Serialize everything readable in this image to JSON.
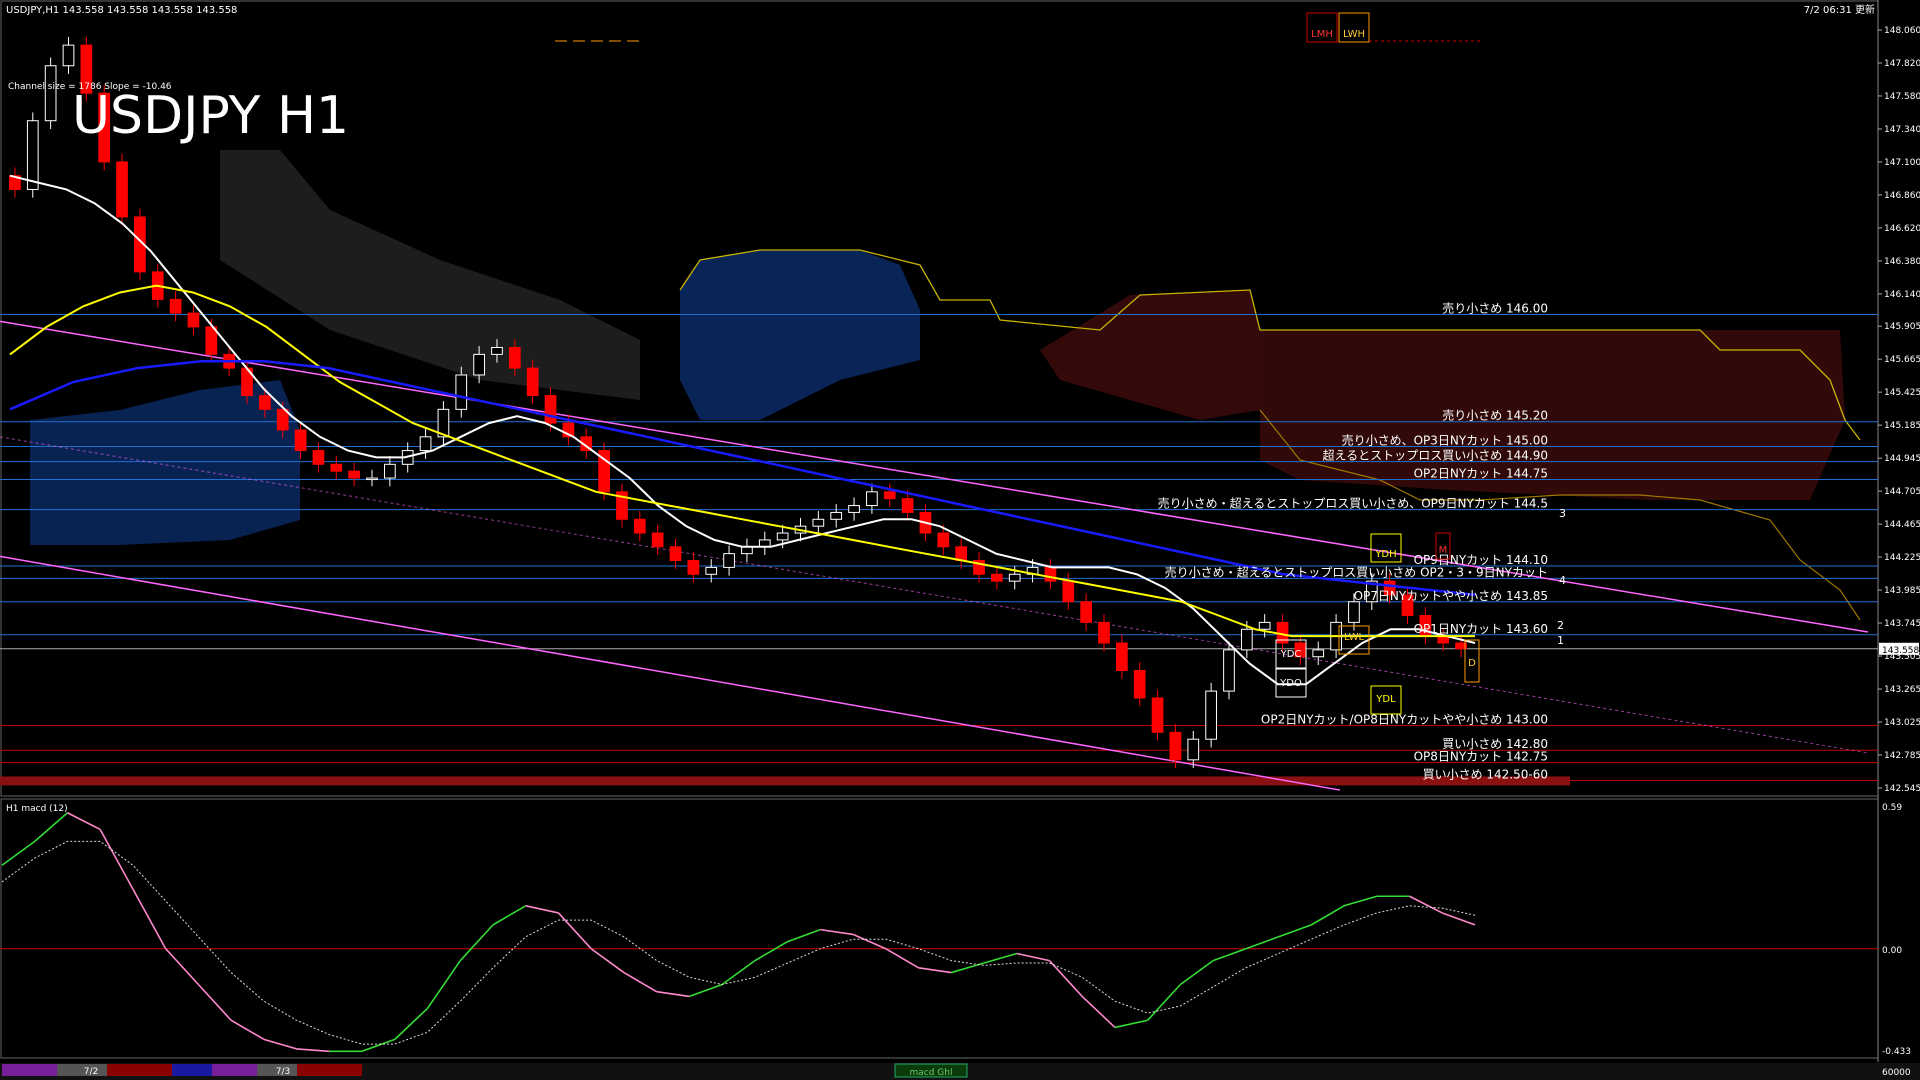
{
  "header": {
    "symbol_info": "USDJPY,H1  143.558 143.558 143.558 143.558",
    "datetime": "7/2 06:31 更新"
  },
  "big_title": "USDJPY H1",
  "channel_text": "Channel size = 1786 Slope = -10.46",
  "top_boxes": {
    "lmh": "LMH",
    "lwh": "LWH"
  },
  "price_axis": {
    "ticks": [
      "148.060",
      "147.820",
      "147.580",
      "147.340",
      "147.100",
      "146.860",
      "146.620",
      "146.380",
      "146.140",
      "145.905",
      "145.665",
      "145.425",
      "145.185",
      "144.945",
      "144.705",
      "144.465",
      "144.225",
      "143.985",
      "143.745",
      "143.505",
      "143.265",
      "143.025",
      "142.785",
      "142.545"
    ],
    "current": "143.558"
  },
  "annotations": [
    {
      "text": "売り小さめ 146.00",
      "price": 145.99
    },
    {
      "text": "売り小さめ 145.20",
      "price": 145.21
    },
    {
      "text": "売り小さめ、OP3日NYカット 145.00",
      "price": 145.03
    },
    {
      "text": "超えるとストップロス買い小さめ 144.90",
      "price": 144.92
    },
    {
      "text": "OP2日NYカット 144.75",
      "price": 144.79
    },
    {
      "text": "売り小さめ・超えるとストップロス買い小さめ、OP9日NYカット 144.5",
      "price": 144.57
    },
    {
      "text": "OP9日NYカット 144.10",
      "price": 144.16
    },
    {
      "text": "売り小さめ・超えるとストップロス買い小さめ OP2・3・9日NYカット",
      "price": 144.07
    },
    {
      "text": "OP7日NYカットやや小さめ 143.85",
      "price": 143.9
    },
    {
      "text": "OP1日NYカット 143.60",
      "price": 143.66
    },
    {
      "text": "OP2日NYカット/OP8日NYカットやや小さめ 143.00",
      "price": 143.0
    },
    {
      "text": "買い小さめ 142.80",
      "price": 142.82
    },
    {
      "text": "OP8日NYカット 142.75",
      "price": 142.73
    },
    {
      "text": "買い小さめ 142.50-60",
      "price": 142.6
    }
  ],
  "level_marks": [
    "3",
    "4",
    "2",
    "1"
  ],
  "boxes": {
    "ydh": "YDH",
    "ydc": "YDC",
    "ydo": "YDO",
    "ydl": "YDL",
    "lwl": "LWL",
    "m": "M",
    "d": "D"
  },
  "macd": {
    "label": "H1  macd (12)",
    "ticks": [
      "0.59",
      "0.00",
      "-0.433"
    ],
    "zero": 0.0
  },
  "bottom_bar": {
    "dates": [
      "7/2",
      "7/3"
    ],
    "tab": "macd Ghl",
    "right": "60000"
  },
  "colors": {
    "background": "#000000",
    "bull": "#ffffff",
    "bear": "#ff0000",
    "ma_white": "#ffffff",
    "ma_yellow": "#ffff00",
    "ma_blue": "#1a1aff",
    "channel": "#ff66ff",
    "level_line": "#1f6fd0",
    "support_line": "#c00000",
    "macd_up": "#33dd33",
    "macd_down": "#ff88cc"
  },
  "chart_data": {
    "type": "candlestick",
    "symbol": "USDJPY",
    "timeframe": "H1",
    "ylim": [
      142.545,
      148.06
    ],
    "close": [
      146.9,
      147.4,
      147.8,
      147.95,
      147.6,
      147.1,
      146.7,
      146.3,
      146.1,
      146.0,
      145.9,
      145.7,
      145.6,
      145.4,
      145.3,
      145.15,
      145.0,
      144.9,
      144.85,
      144.8,
      144.8,
      144.9,
      145.0,
      145.1,
      145.3,
      145.55,
      145.7,
      145.75,
      145.6,
      145.4,
      145.2,
      145.1,
      145.0,
      144.7,
      144.5,
      144.4,
      144.3,
      144.2,
      144.1,
      144.15,
      144.25,
      144.3,
      144.35,
      144.4,
      144.45,
      144.5,
      144.55,
      144.6,
      144.7,
      144.65,
      144.55,
      144.4,
      144.3,
      144.2,
      144.1,
      144.05,
      144.1,
      144.15,
      144.05,
      143.9,
      143.75,
      143.6,
      143.4,
      143.2,
      142.95,
      142.75,
      142.9,
      143.25,
      143.55,
      143.7,
      143.75,
      143.6,
      143.5,
      143.55,
      143.75,
      143.9,
      144.05,
      143.95,
      143.8,
      143.65,
      143.6,
      143.558
    ],
    "ma_white": [
      147.0,
      146.95,
      146.9,
      146.8,
      146.65,
      146.45,
      146.2,
      145.95,
      145.7,
      145.45,
      145.25,
      145.1,
      145.0,
      144.95,
      144.95,
      145.0,
      145.1,
      145.2,
      145.25,
      145.2,
      145.1,
      144.95,
      144.8,
      144.6,
      144.45,
      144.35,
      144.3,
      144.3,
      144.35,
      144.4,
      144.45,
      144.5,
      144.5,
      144.45,
      144.35,
      144.25,
      144.2,
      144.15,
      144.15,
      144.15,
      144.1,
      144.0,
      143.85,
      143.65,
      143.45,
      143.3,
      143.3,
      143.45,
      143.6,
      143.7,
      143.7,
      143.65,
      143.6
    ],
    "ma_yellow": [
      145.7,
      145.9,
      146.05,
      146.15,
      146.2,
      146.15,
      146.05,
      145.9,
      145.7,
      145.5,
      145.35,
      145.2,
      145.1,
      145.0,
      144.9,
      144.8,
      144.7,
      144.65,
      144.6,
      144.55,
      144.5,
      144.45,
      144.4,
      144.35,
      144.3,
      144.25,
      144.2,
      144.15,
      144.1,
      144.05,
      144.0,
      143.95,
      143.9,
      143.8,
      143.7,
      143.65,
      143.65,
      143.65,
      143.65,
      143.65,
      143.65
    ],
    "ma_blue": [
      145.3,
      145.5,
      145.6,
      145.65,
      145.65,
      145.6,
      145.5,
      145.4,
      145.3,
      145.2,
      145.1,
      145.0,
      144.9,
      144.8,
      144.7,
      144.6,
      144.5,
      144.4,
      144.3,
      144.2,
      144.1,
      144.05,
      144.0,
      143.95
    ],
    "macd": [
      0.35,
      0.45,
      0.57,
      0.5,
      0.25,
      0.0,
      -0.15,
      -0.3,
      -0.38,
      -0.42,
      -0.43,
      -0.43,
      -0.38,
      -0.25,
      -0.05,
      0.1,
      0.18,
      0.15,
      0.0,
      -0.1,
      -0.18,
      -0.2,
      -0.15,
      -0.05,
      0.03,
      0.08,
      0.06,
      0.0,
      -0.08,
      -0.1,
      -0.06,
      -0.02,
      -0.05,
      -0.2,
      -0.33,
      -0.3,
      -0.15,
      -0.05,
      0.0,
      0.05,
      0.1,
      0.18,
      0.22,
      0.22,
      0.15,
      0.1
    ],
    "macd_signal": [
      0.28,
      0.38,
      0.45,
      0.45,
      0.35,
      0.2,
      0.05,
      -0.1,
      -0.22,
      -0.3,
      -0.36,
      -0.4,
      -0.4,
      -0.35,
      -0.22,
      -0.08,
      0.05,
      0.12,
      0.12,
      0.05,
      -0.05,
      -0.12,
      -0.15,
      -0.12,
      -0.06,
      0.0,
      0.04,
      0.04,
      0.0,
      -0.05,
      -0.07,
      -0.06,
      -0.06,
      -0.12,
      -0.22,
      -0.27,
      -0.24,
      -0.16,
      -0.08,
      -0.02,
      0.04,
      0.1,
      0.15,
      0.18,
      0.17,
      0.14
    ]
  }
}
